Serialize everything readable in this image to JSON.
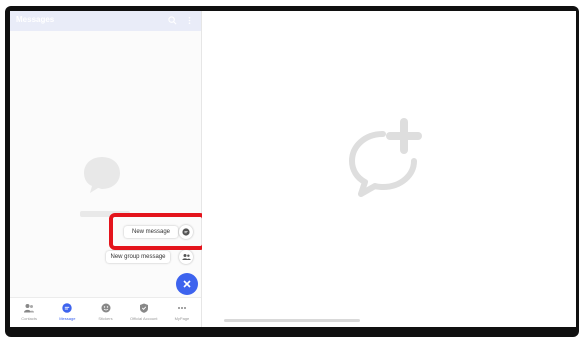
{
  "header": {
    "title": "Messages"
  },
  "popups": {
    "new_message": "New message",
    "new_group_message": "New group message"
  },
  "tabs": [
    {
      "label": "Contacts",
      "icon": "contacts-icon"
    },
    {
      "label": "Message",
      "icon": "message-icon"
    },
    {
      "label": "Stickers",
      "icon": "sticker-icon"
    },
    {
      "label": "Official Account",
      "icon": "official-account-icon"
    },
    {
      "label": "MyPage",
      "icon": "more-icon"
    }
  ],
  "colors": {
    "accent": "#3d63ee",
    "highlight": "#e4141c",
    "header_bg": "#e9ecf8"
  }
}
